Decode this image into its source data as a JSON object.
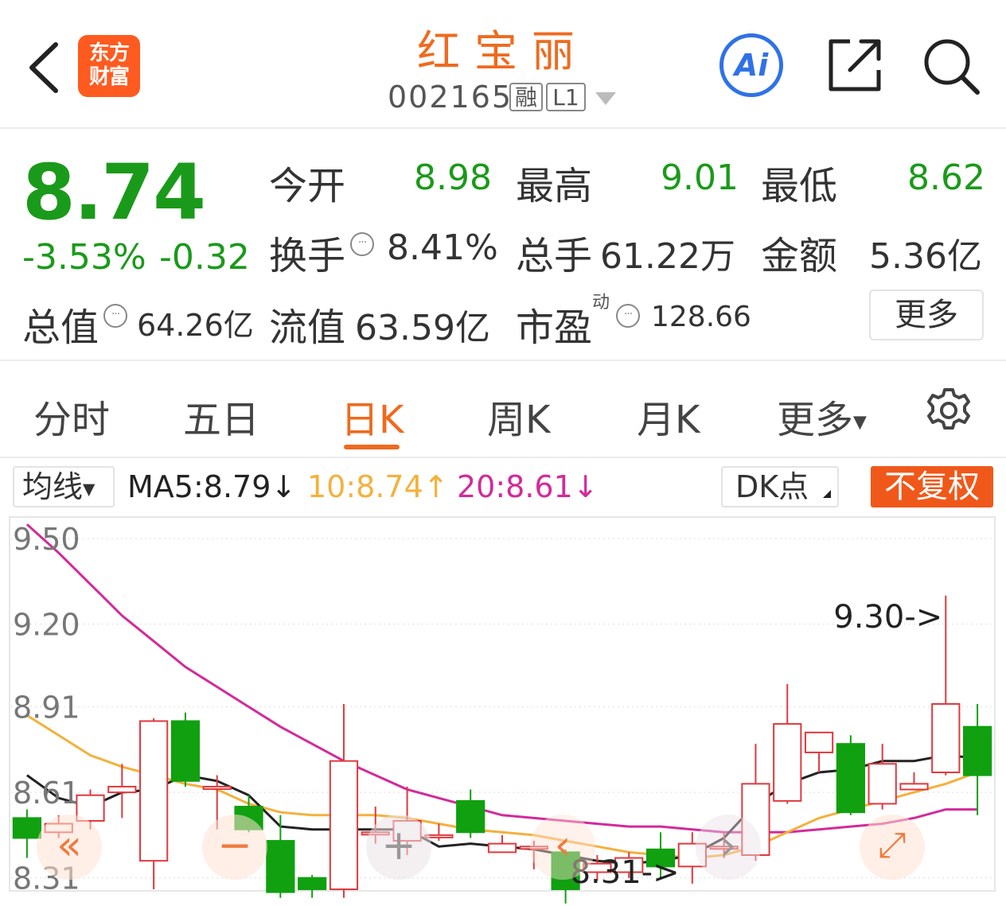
{
  "header": {
    "stock_name": "红宝丽",
    "stock_code": "002165",
    "badge_margin": "融",
    "badge_level": "L1",
    "logo_line1": "东方",
    "logo_line2": "财富",
    "ai_label": "Ai"
  },
  "quote": {
    "price": "8.74",
    "change_pct": "-3.53%",
    "change_amt": "-0.32",
    "open_label": "今开",
    "open_value": "8.98",
    "high_label": "最高",
    "high_value": "9.01",
    "low_label": "最低",
    "low_value": "8.62",
    "turnover_label": "换手",
    "turnover_value": "8.41%",
    "volume_label": "总手",
    "volume_value": "61.22万",
    "amount_label": "金额",
    "amount_value": "5.36亿",
    "mktcap_label": "总值",
    "mktcap_value": "64.26亿",
    "float_label": "流值",
    "float_value": "63.59亿",
    "pe_label": "市盈",
    "pe_sup": "动",
    "pe_value": "128.66",
    "more_label": "更多",
    "info_glyph": "···"
  },
  "tabs": [
    "分时",
    "五日",
    "日K",
    "周K",
    "月K",
    "更多"
  ],
  "active_tab": "日K",
  "indicator": {
    "ma_select": "均线",
    "ma5": "MA5:8.79",
    "ma10": "10:8.74",
    "ma20": "20:8.61",
    "arrow_down": "↓",
    "arrow_up": "↑",
    "dk_label": "DK点",
    "fq_label": "不复权"
  },
  "colors": {
    "up": "#e0393e",
    "down": "#10a010",
    "ma5": "#222222",
    "ma10": "#f3b13c",
    "ma20": "#d22a9a",
    "accent": "#ef6a1e"
  },
  "chart_data": {
    "type": "candlestick",
    "y_ticks": [
      "9.50",
      "9.20",
      "8.91",
      "8.61",
      "8.31"
    ],
    "ylim": [
      8.27,
      9.57
    ],
    "max_annotation": "9.30->",
    "min_annotation": "8.31->",
    "candles": [
      {
        "o": 8.52,
        "c": 8.45,
        "h": 8.55,
        "l": 8.38
      },
      {
        "o": 8.47,
        "c": 8.5,
        "h": 8.53,
        "l": 8.45
      },
      {
        "o": 8.51,
        "c": 8.6,
        "h": 8.62,
        "l": 8.48
      },
      {
        "o": 8.61,
        "c": 8.63,
        "h": 8.71,
        "l": 8.52
      },
      {
        "o": 8.37,
        "c": 8.86,
        "h": 8.87,
        "l": 8.27
      },
      {
        "o": 8.86,
        "c": 8.65,
        "h": 8.89,
        "l": 8.63
      },
      {
        "o": 8.63,
        "c": 8.63,
        "h": 8.67,
        "l": 8.48
      },
      {
        "o": 8.56,
        "c": 8.48,
        "h": 8.6,
        "l": 8.47
      },
      {
        "o": 8.44,
        "c": 8.26,
        "h": 8.53,
        "l": 8.24
      },
      {
        "o": 8.31,
        "c": 8.27,
        "h": 8.32,
        "l": 8.24
      },
      {
        "o": 8.27,
        "c": 8.72,
        "h": 8.92,
        "l": 8.24
      },
      {
        "o": 8.47,
        "c": 8.47,
        "h": 8.56,
        "l": 8.43
      },
      {
        "o": 8.44,
        "c": 8.51,
        "h": 8.63,
        "l": 8.39
      },
      {
        "o": 8.46,
        "c": 8.46,
        "h": 8.5,
        "l": 8.44
      },
      {
        "o": 8.58,
        "c": 8.47,
        "h": 8.62,
        "l": 8.45
      },
      {
        "o": 8.4,
        "c": 8.43,
        "h": 8.46,
        "l": 8.4
      },
      {
        "o": 8.42,
        "c": 8.42,
        "h": 8.44,
        "l": 8.34
      },
      {
        "o": 8.4,
        "c": 8.27,
        "h": 8.41,
        "l": 8.22
      },
      {
        "o": 8.33,
        "c": 8.36,
        "h": 8.39,
        "l": 8.3
      },
      {
        "o": 8.33,
        "c": 8.38,
        "h": 8.4,
        "l": 8.31
      },
      {
        "o": 8.41,
        "c": 8.35,
        "h": 8.47,
        "l": 8.31
      },
      {
        "o": 8.35,
        "c": 8.43,
        "h": 8.47,
        "l": 8.29
      },
      {
        "o": 8.42,
        "c": 8.42,
        "h": 8.47,
        "l": 8.38
      },
      {
        "o": 8.39,
        "c": 8.64,
        "h": 8.78,
        "l": 8.37
      },
      {
        "o": 8.58,
        "c": 8.85,
        "h": 8.99,
        "l": 8.57
      },
      {
        "o": 8.75,
        "c": 8.82,
        "h": 8.82,
        "l": 8.68
      },
      {
        "o": 8.78,
        "c": 8.54,
        "h": 8.81,
        "l": 8.53
      },
      {
        "o": 8.57,
        "c": 8.71,
        "h": 8.78,
        "l": 8.55
      },
      {
        "o": 8.62,
        "c": 8.64,
        "h": 8.68,
        "l": 8.62
      },
      {
        "o": 8.68,
        "c": 8.92,
        "h": 9.3,
        "l": 8.67
      },
      {
        "o": 8.84,
        "c": 8.67,
        "h": 8.92,
        "l": 8.53
      }
    ],
    "ma5": [
      8.67,
      8.59,
      8.56,
      8.61,
      8.62,
      8.67,
      8.65,
      8.6,
      8.49,
      8.48,
      8.48,
      8.48,
      8.48,
      8.42,
      8.43,
      8.42,
      8.41,
      8.39,
      8.37,
      8.36,
      8.37,
      8.39,
      8.45,
      8.57,
      8.64,
      8.68,
      8.69,
      8.72,
      8.72,
      8.74,
      8.73
    ],
    "ma10": [
      8.88,
      8.81,
      8.74,
      8.7,
      8.67,
      8.64,
      8.62,
      8.57,
      8.54,
      8.53,
      8.53,
      8.53,
      8.52,
      8.5,
      8.48,
      8.47,
      8.46,
      8.44,
      8.42,
      8.4,
      8.39,
      8.38,
      8.39,
      8.42,
      8.47,
      8.52,
      8.55,
      8.58,
      8.61,
      8.64,
      8.68
    ],
    "ma20": [
      9.55,
      9.45,
      9.34,
      9.23,
      9.14,
      9.05,
      8.98,
      8.91,
      8.84,
      8.78,
      8.72,
      8.67,
      8.62,
      8.59,
      8.56,
      8.53,
      8.52,
      8.51,
      8.5,
      8.49,
      8.49,
      8.48,
      8.47,
      8.47,
      8.47,
      8.48,
      8.49,
      8.5,
      8.52,
      8.55,
      8.55
    ]
  },
  "overlay_controls": [
    "«",
    "−",
    "+",
    "‹",
    "›",
    "⤢"
  ]
}
